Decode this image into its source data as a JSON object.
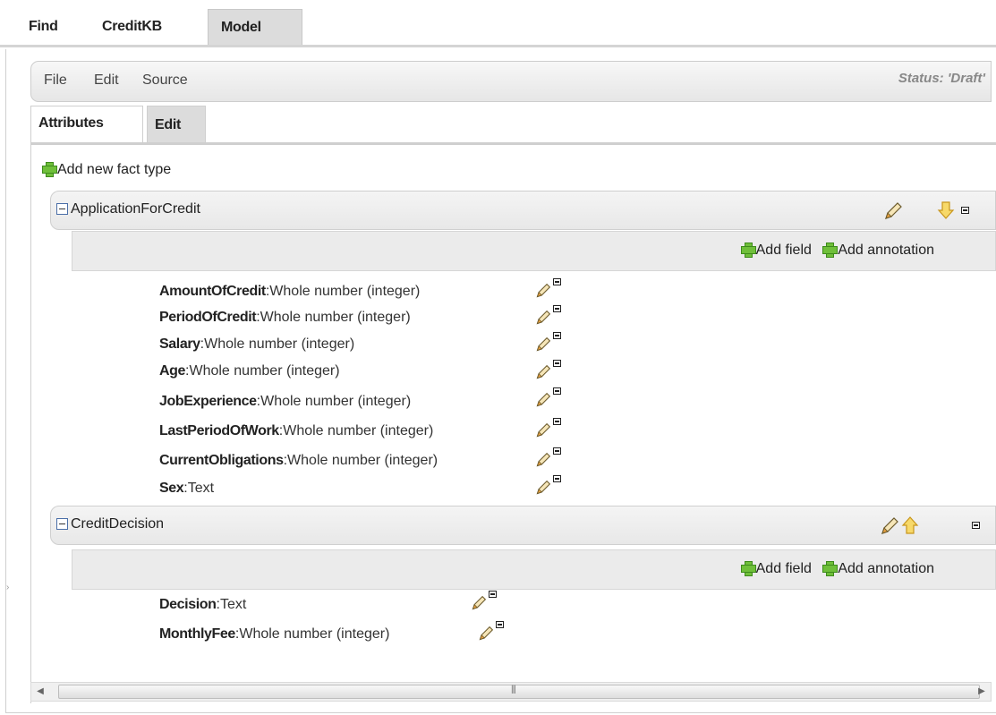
{
  "top_tabs": [
    "Find",
    "CreditKB",
    "Model"
  ],
  "menu": {
    "items": [
      "File",
      "Edit",
      "Source"
    ],
    "status": "Status: 'Draft'"
  },
  "sub_tabs": [
    "Attributes",
    "Edit"
  ],
  "add_fact_type": "Add new fact type",
  "actions": {
    "add_field": "Add field",
    "add_annotation": "Add annotation"
  },
  "facts": [
    {
      "name": "ApplicationForCredit",
      "fields": [
        {
          "name": "AmountOfCredit",
          "type": ":Whole number (integer)"
        },
        {
          "name": "PeriodOfCredit",
          "type": ":Whole number (integer)"
        },
        {
          "name": "Salary",
          "type": ":Whole number (integer)"
        },
        {
          "name": "Age",
          "type": ":Whole number (integer)"
        },
        {
          "name": "JobExperience",
          "type": ":Whole number (integer)"
        },
        {
          "name": "LastPeriodOfWork",
          "type": ":Whole number (integer)"
        },
        {
          "name": "CurrentObligations",
          "type": ":Whole number (integer)"
        },
        {
          "name": "Sex",
          "type": ":Text"
        }
      ]
    },
    {
      "name": "CreditDecision",
      "fields": [
        {
          "name": "Decision",
          "type": ":Text"
        },
        {
          "name": "MonthlyFee",
          "type": ":Whole number (integer)"
        }
      ]
    }
  ],
  "icons": {
    "edit": "pencil-icon",
    "move_down": "arrow-down-icon",
    "move_up": "arrow-up-icon",
    "remove": "collapse-icon",
    "add": "plus-icon",
    "toggle": "minus-box-icon"
  },
  "colors": {
    "plus_green": "#6fbf3a",
    "arrow_yellow": "#f2c230",
    "pencil_orange": "#e8a040"
  }
}
